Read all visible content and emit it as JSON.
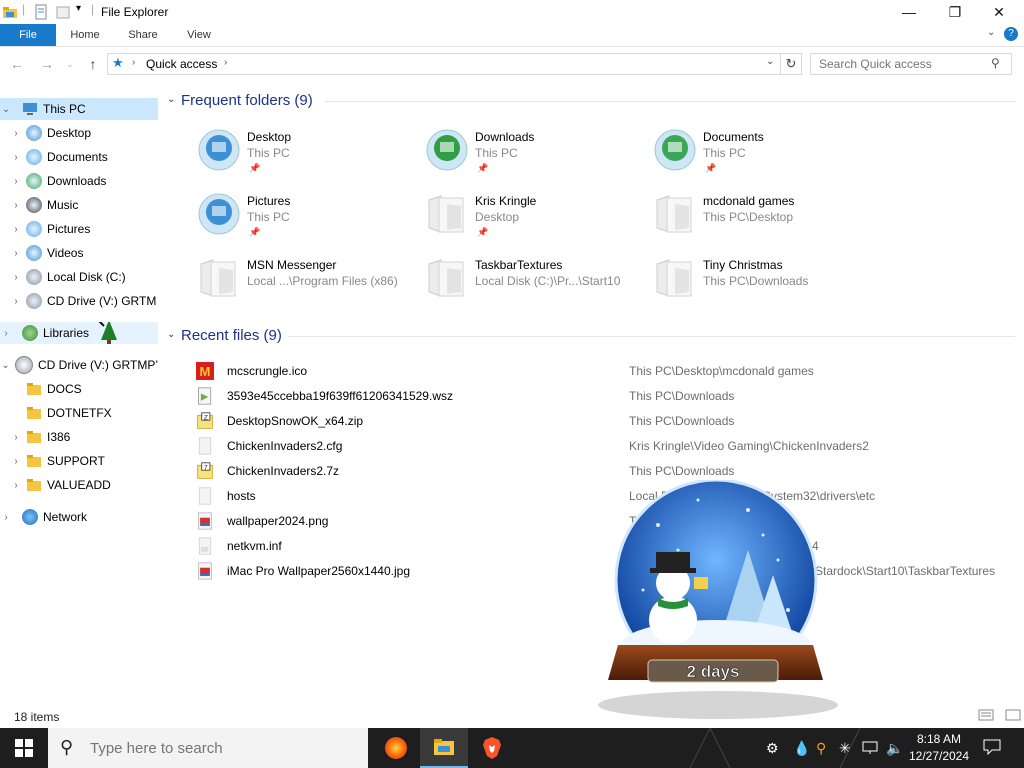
{
  "window": {
    "title": "File Explorer"
  },
  "ribbon": {
    "tabs": [
      "File",
      "Home",
      "Share",
      "View"
    ]
  },
  "address": {
    "path": "Quick access",
    "search_placeholder": "Search Quick access"
  },
  "sidebar": {
    "this_pc": "This PC",
    "items": [
      {
        "label": "Desktop",
        "icon": "desktop-icon"
      },
      {
        "label": "Documents",
        "icon": "documents-icon"
      },
      {
        "label": "Downloads",
        "icon": "downloads-icon"
      },
      {
        "label": "Music",
        "icon": "music-icon"
      },
      {
        "label": "Pictures",
        "icon": "pictures-icon"
      },
      {
        "label": "Videos",
        "icon": "videos-icon"
      },
      {
        "label": "Local Disk (C:)",
        "icon": "disk-icon"
      },
      {
        "label": "CD Drive (V:) GRTM",
        "icon": "cd-drive-icon"
      }
    ],
    "libraries": "Libraries",
    "cd_drive": "CD Drive (V:) GRTMP’",
    "cd_children": [
      "DOCS",
      "DOTNETFX",
      "I386",
      "SUPPORT",
      "VALUEADD"
    ],
    "network": "Network"
  },
  "frequent": {
    "header": "Frequent folders (9)",
    "tiles": [
      {
        "name": "Desktop",
        "location": "This PC",
        "pinned": true,
        "icon": "desktop-folder-icon"
      },
      {
        "name": "Downloads",
        "location": "This PC",
        "pinned": true,
        "icon": "downloads-folder-icon"
      },
      {
        "name": "Documents",
        "location": "This PC",
        "pinned": true,
        "icon": "documents-folder-icon"
      },
      {
        "name": "Pictures",
        "location": "This PC",
        "pinned": true,
        "icon": "pictures-folder-icon"
      },
      {
        "name": "Kris Kringle",
        "location": "Desktop",
        "pinned": true,
        "icon": "folder-icon"
      },
      {
        "name": "mcdonald games",
        "location": "This PC\\Desktop",
        "pinned": false,
        "icon": "folder-icon"
      },
      {
        "name": "MSN Messenger",
        "location": "Local ...\\Program Files (x86)",
        "pinned": false,
        "icon": "folder-icon"
      },
      {
        "name": "TaskbarTextures",
        "location": "Local Disk (C:)\\Pr...\\Start10",
        "pinned": false,
        "icon": "folder-icon"
      },
      {
        "name": "Tiny Christmas",
        "location": "This PC\\Downloads",
        "pinned": false,
        "icon": "folder-icon"
      }
    ]
  },
  "recent": {
    "header": "Recent files (9)",
    "files": [
      {
        "name": "mcscrungle.ico",
        "location": "This PC\\Desktop\\mcdonald games",
        "icon": "mcdonalds-icon"
      },
      {
        "name": "3593e45ccebba19f639ff61206341529.wsz",
        "location": "This PC\\Downloads",
        "icon": "skin-file-icon"
      },
      {
        "name": "DesktopSnowOK_x64.zip",
        "location": "This PC\\Downloads",
        "icon": "zip-file-icon"
      },
      {
        "name": "ChickenInvaders2.cfg",
        "location": "Kris Kringle\\Video Gaming\\ChickenInvaders2",
        "icon": "generic-file-icon"
      },
      {
        "name": "ChickenInvaders2.7z",
        "location": "This PC\\Downloads",
        "icon": "7z-file-icon"
      },
      {
        "name": "hosts",
        "location": "Local Di",
        "location_tail": "System32\\drivers\\etc",
        "icon": "generic-file-icon"
      },
      {
        "name": "wallpaper2024.png",
        "location": "Th",
        "icon": "image-file-icon"
      },
      {
        "name": "netkvm.inf",
        "location": "",
        "location_tail": "4",
        "icon": "inf-file-icon"
      },
      {
        "name": "iMac Pro Wallpaper2560x1440.jpg",
        "location": "",
        "location_tail": "Stardock\\Start10\\TaskbarTextures",
        "icon": "image-file-icon"
      }
    ]
  },
  "status": {
    "items": "18 items"
  },
  "snowglobe": {
    "label": "2 days"
  },
  "taskbar": {
    "search_placeholder": "Type here to search",
    "apps": [
      "firefox-icon",
      "file-explorer-icon",
      "brave-icon"
    ],
    "time": "8:18 AM",
    "date": "12/27/2024"
  },
  "colors": {
    "accent": "#1979ca",
    "selected": "#cce8ff",
    "header": "#1e3287",
    "taskbar": "#1e1e1e"
  }
}
